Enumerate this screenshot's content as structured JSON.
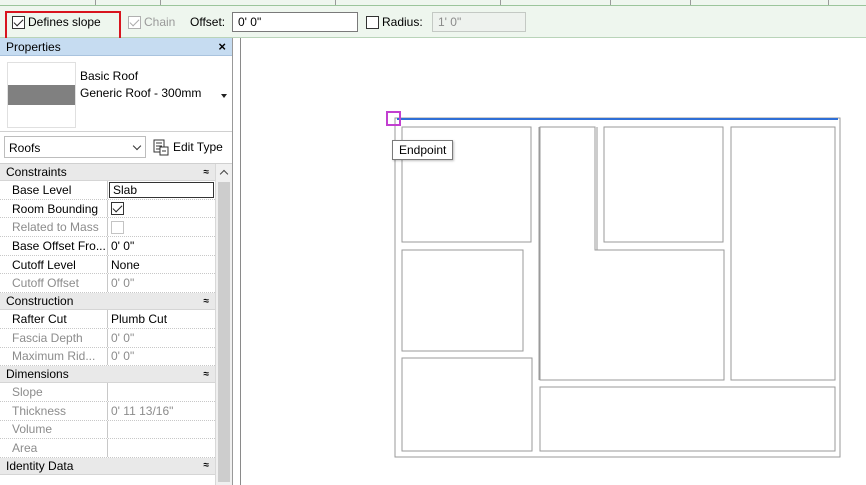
{
  "options_bar": {
    "defines_slope": {
      "label": "Defines slope",
      "checked": true
    },
    "chain": {
      "label": "Chain",
      "checked": true,
      "enabled": false
    },
    "offset": {
      "label": "Offset:",
      "value": "0'  0\""
    },
    "radius": {
      "label": "Radius:",
      "checked": false,
      "value": "1'  0\""
    }
  },
  "properties": {
    "title": "Properties",
    "close_glyph": "×",
    "type_selector": {
      "family": "Basic Roof",
      "type": "Generic Roof - 300mm"
    },
    "filter": {
      "value": "Roofs"
    },
    "edit_type_label": "Edit Type",
    "collapse_glyph": "≈",
    "sections": [
      {
        "name": "Constraints",
        "rows": [
          {
            "key": "Base Level",
            "value": "Slab",
            "enabled": true,
            "selected": true
          },
          {
            "key": "Room Bounding",
            "value": "",
            "checkbox": true,
            "checked": true,
            "enabled": true
          },
          {
            "key": "Related to Mass",
            "value": "",
            "checkbox": true,
            "checked": false,
            "enabled": false
          },
          {
            "key": "Base Offset Fro...",
            "value": "0'  0\"",
            "enabled": true
          },
          {
            "key": "Cutoff Level",
            "value": "None",
            "enabled": true
          },
          {
            "key": "Cutoff Offset",
            "value": "0'  0\"",
            "enabled": false
          }
        ]
      },
      {
        "name": "Construction",
        "rows": [
          {
            "key": "Rafter Cut",
            "value": "Plumb Cut",
            "enabled": true
          },
          {
            "key": "Fascia Depth",
            "value": "0'  0\"",
            "enabled": false
          },
          {
            "key": "Maximum Rid...",
            "value": "0'  0\"",
            "enabled": false
          }
        ]
      },
      {
        "name": "Dimensions",
        "rows": [
          {
            "key": "Slope",
            "value": "",
            "enabled": false
          },
          {
            "key": "Thickness",
            "value": "0'  11 13/16\"",
            "enabled": false
          },
          {
            "key": "Volume",
            "value": "",
            "enabled": false
          },
          {
            "key": "Area",
            "value": "",
            "enabled": false
          }
        ]
      },
      {
        "name": "Identity Data",
        "rows": []
      }
    ]
  },
  "canvas": {
    "snap_tooltip": "Endpoint",
    "colors": {
      "sketch_line": "#2f6fd6",
      "snap_marker": "#c23fd0",
      "walls": "#9a9a9a"
    }
  }
}
